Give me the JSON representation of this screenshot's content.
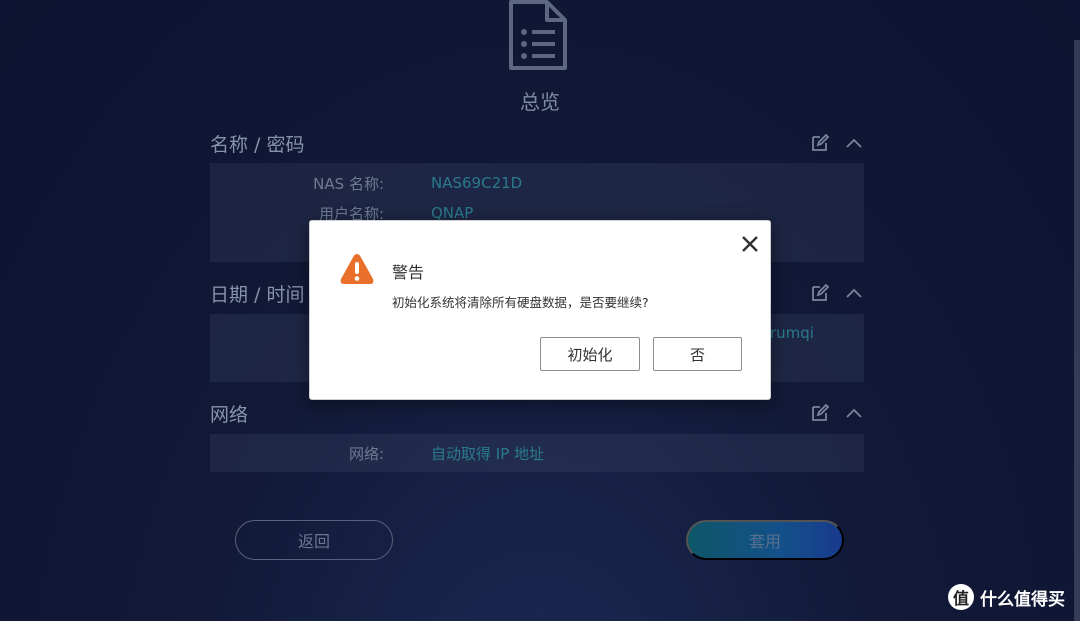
{
  "page": {
    "title": "总览"
  },
  "sections": {
    "name_password": {
      "title": "名称 / 密码",
      "rows": [
        {
          "label": "NAS 名称:",
          "value": "NAS69C21D"
        },
        {
          "label": "用户名称:",
          "value": "QNAP"
        }
      ]
    },
    "datetime": {
      "title": "日期 / 时间",
      "partial_value": "rumqi"
    },
    "network": {
      "title": "网络",
      "rows": [
        {
          "label": "网络:",
          "value": "自动取得 IP 地址"
        }
      ]
    }
  },
  "footer": {
    "back_label": "返回",
    "apply_label": "套用"
  },
  "dialog": {
    "title": "警告",
    "message": "初始化系统将清除所有硬盘数据，是否要继续?",
    "confirm_label": "初始化",
    "cancel_label": "否"
  },
  "watermark": {
    "logo_char": "值",
    "text": "什么值得买"
  },
  "colors": {
    "warning": "#e8702a",
    "apply_button": "#14508a",
    "background": "#121a38"
  }
}
